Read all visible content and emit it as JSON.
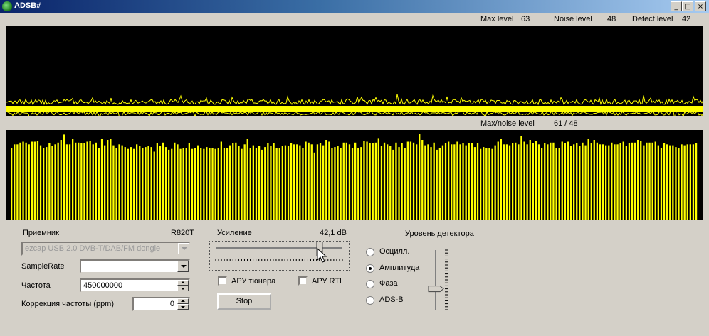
{
  "window": {
    "title": "ADSB#",
    "minimize_glyph": "_",
    "maximize_glyph": "□",
    "close_glyph": "×"
  },
  "status": {
    "max_level_label": "Max level",
    "max_level_value": "63",
    "noise_level_label": "Noise level",
    "noise_level_value": "48",
    "detect_level_label": "Detect level",
    "detect_level_value": "42",
    "max_noise_label": "Max/noise level",
    "max_noise_value": "61  /  48"
  },
  "waveform": {
    "color": "#ffff00",
    "baseline_level": 48,
    "peak_level": 63
  },
  "spectrum": {
    "color": "#ffff00",
    "bar_heights": [
      0.8,
      0.84,
      0.84,
      0.86,
      0.87,
      0.86,
      0.84,
      0.87,
      0.87,
      0.88,
      0.83,
      0.8,
      0.81,
      0.85,
      0.82,
      0.84,
      0.86,
      0.89,
      0.95,
      0.84,
      0.84,
      0.9,
      0.86,
      0.86,
      0.85,
      0.85,
      0.87,
      0.88,
      0.84,
      0.86,
      0.8,
      0.9,
      0.83,
      0.89,
      0.9,
      0.83,
      0.8,
      0.84,
      0.83,
      0.81,
      0.79,
      0.81,
      0.79,
      0.84,
      0.82,
      0.8,
      0.81,
      0.82,
      0.81,
      0.76,
      0.85,
      0.82,
      0.86,
      0.81,
      0.78,
      0.79,
      0.86,
      0.84,
      0.79,
      0.8,
      0.8,
      0.85,
      0.79,
      0.8,
      0.83,
      0.8,
      0.79,
      0.81,
      0.8,
      0.8,
      0.79,
      0.8,
      0.87,
      0.8,
      0.8,
      0.83,
      0.85,
      0.86,
      0.82,
      0.79,
      0.84,
      0.9,
      0.8,
      0.83,
      0.8,
      0.82,
      0.78,
      0.81,
      0.85,
      0.82,
      0.85,
      0.8,
      0.8,
      0.82,
      0.83,
      0.82,
      0.85,
      0.84,
      0.84,
      0.83,
      0.8,
      0.87,
      0.86,
      0.84,
      0.75,
      0.84,
      0.85,
      0.83,
      0.89,
      0.87,
      0.8,
      0.81,
      0.82,
      0.8,
      0.86,
      0.86,
      0.84,
      0.8,
      0.86,
      0.8,
      0.81,
      0.88,
      0.87,
      0.85,
      0.85,
      0.86,
      0.91,
      0.82,
      0.86,
      0.84,
      0.82,
      0.78,
      0.86,
      0.81,
      0.85,
      0.8,
      0.87,
      0.87,
      0.86,
      0.84,
      0.96,
      0.89,
      0.83,
      0.84,
      0.81,
      0.86,
      0.78,
      0.8,
      0.83,
      0.85,
      0.87,
      0.84,
      0.84,
      0.87,
      0.84,
      0.85,
      0.83,
      0.85,
      0.85,
      0.81,
      0.85,
      0.79,
      0.81,
      0.8,
      0.8,
      0.79,
      0.83,
      0.87,
      0.9,
      0.84,
      0.84,
      0.83,
      0.85,
      0.86,
      0.84,
      0.93,
      0.87,
      0.84,
      0.89,
      0.85,
      0.88,
      0.84,
      0.8,
      0.85,
      0.84,
      0.86,
      0.86,
      0.8,
      0.8,
      0.87,
      0.85,
      0.87,
      0.82,
      0.84,
      0.85,
      0.82,
      0.86,
      0.83,
      0.9,
      0.85,
      0.89,
      0.86,
      0.84,
      0.84,
      0.83,
      0.83,
      0.86,
      0.84,
      0.84,
      0.85,
      0.87,
      0.82,
      0.85,
      0.86,
      0.86,
      0.89,
      0.88,
      0.83,
      0.86,
      0.86,
      0.86,
      0.87,
      0.83,
      0.8,
      0.85,
      0.84,
      0.83,
      0.83,
      0.81,
      0.8,
      0.84,
      0.83,
      0.84,
      0.84,
      0.84,
      0.85
    ]
  },
  "receiver": {
    "label": "Приемник",
    "tuner": "R820T",
    "device_value": "ezcap USB 2.0 DVB-T/DAB/FM dongle",
    "samplerate_label": "SampleRate",
    "samplerate_value": "",
    "frequency_label": "Частота",
    "frequency_value": "450000000",
    "ppm_label": "Коррекция частоты (ppm)",
    "ppm_value": "0"
  },
  "gain": {
    "label": "Усиление",
    "value_text": "42,1 dB",
    "slider_fraction": 0.82,
    "agc_tuner_label": "АРУ тюнера",
    "agc_tuner_checked": false,
    "agc_rtl_label": "АРУ RTL",
    "agc_rtl_checked": false,
    "stop_button": "Stop"
  },
  "detector": {
    "title": "Уровень детектора",
    "options": [
      {
        "label": "Осцилл.",
        "selected": false
      },
      {
        "label": "Амплитуда",
        "selected": true
      },
      {
        "label": "Фаза",
        "selected": false
      },
      {
        "label": "ADS-B",
        "selected": false
      }
    ],
    "slider_fraction": 0.35
  }
}
